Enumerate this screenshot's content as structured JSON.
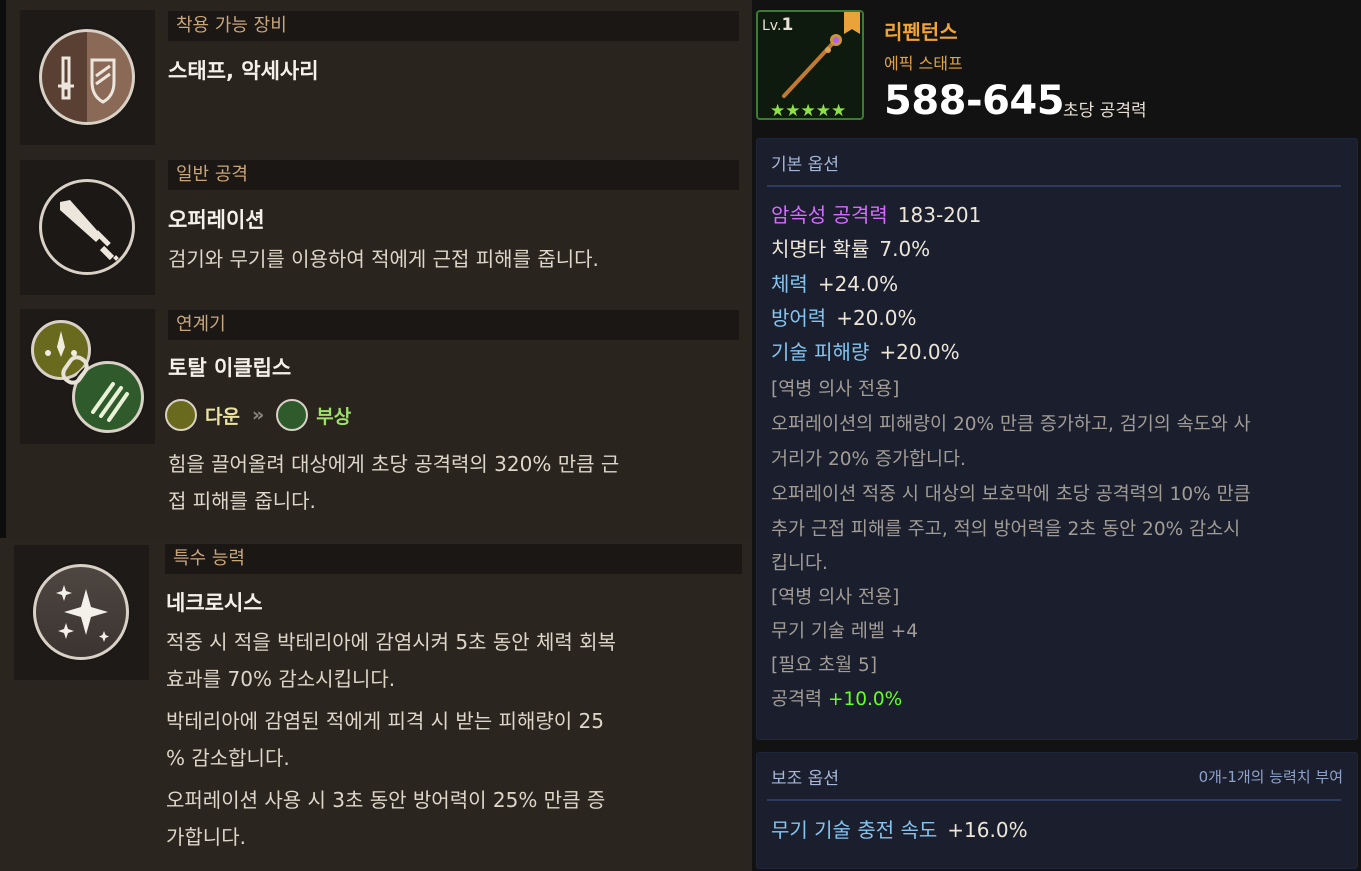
{
  "left": {
    "equip": {
      "header": "착용 가능 장비",
      "title": "스태프, 악세사리"
    },
    "normal_attack": {
      "header": "일반 공격",
      "title": "오퍼레이션",
      "desc": "검기와 무기를 이용하여 적에게 근접 피해를 줍니다."
    },
    "combo": {
      "header": "연계기",
      "title": "토탈 이클립스",
      "chain_from": "다운",
      "chain_arrow": "»",
      "chain_to": "부상",
      "desc_line1": "힘을 끌어올려 대상에게 초당 공격력의 320% 만큼 근",
      "desc_line2": "접 피해를 줍니다."
    },
    "special": {
      "header": "특수 능력",
      "title": "네크로시스",
      "desc_lines": [
        "적중 시 적을 박테리아에 감염시켜 5초 동안 체력 회복",
        "효과를 70% 감소시킵니다.",
        "박테리아에 감염된 적에게 피격 시 받는 피해량이 25",
        "% 감소합니다.",
        "오퍼레이션 사용 시 3초 동안 방어력이 25% 만큼 증",
        "가합니다."
      ]
    }
  },
  "item": {
    "level_prefix": "Lv.",
    "level": "1",
    "stars": "★★★★★",
    "name": "리펜턴스",
    "type": "에픽 스태프",
    "attack": "588-645",
    "attack_label": "초당 공격력",
    "icon": "staff-weapon-icon"
  },
  "basic_options": {
    "header": "기본 옵션",
    "stats": [
      {
        "name": "암속성 공격력",
        "value": "183-201"
      },
      {
        "name": "치명타 확률",
        "value": "7.0%"
      },
      {
        "name": "체력",
        "value": "+24.0%"
      },
      {
        "name": "방어력",
        "value": "+20.0%"
      },
      {
        "name": "기술 피해량",
        "value": "+20.0%"
      }
    ],
    "lines": [
      "[역병 의사 전용]",
      "오퍼레이션의 피해량이 20% 만큼 증가하고, 검기의 속도와 사",
      "거리가 20% 증가합니다.",
      "오퍼레이션 적중 시 대상의 보호막에 초당 공격력의 10% 만큼",
      "추가 근접 피해를 주고, 적의 방어력을 2초 동안 20% 감소시",
      "킵니다.",
      "[역병 의사 전용]",
      "무기 기술 레벨 +4",
      "[필요 초월 5]"
    ],
    "transcend_stat": "공격력",
    "transcend_value": "+10.0%"
  },
  "sub_options": {
    "header": "보조 옵션",
    "note": "0개-1개의 능력치 부여",
    "stat_name": "무기 기술 충전 속도",
    "stat_value": "+16.0%"
  },
  "colors": {
    "epic": "#f0a435",
    "option_green": "#66ff22",
    "dark_element": "#d66bff",
    "stat_blue": "#84c4f0",
    "panel_bg": "#1a1e2d"
  }
}
